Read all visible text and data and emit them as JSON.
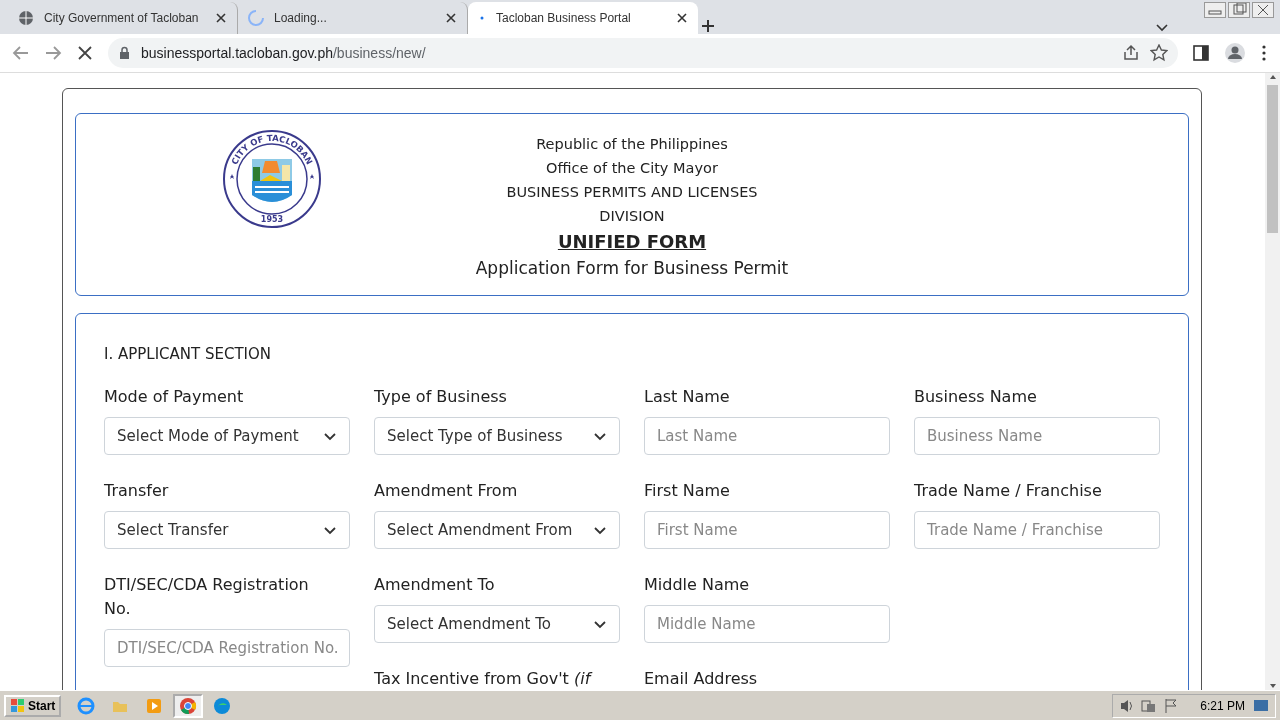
{
  "browser": {
    "tabs": [
      {
        "title": "City Government of Tacloban",
        "selected": false
      },
      {
        "title": "Loading...",
        "selected": false
      },
      {
        "title": "Tacloban Business Portal",
        "selected": true
      }
    ],
    "url_host": "businessportal.tacloban.gov.ph",
    "url_path": "/business/new/"
  },
  "header": {
    "lines": [
      "Republic of the Philippines",
      "Office of the City Mayor",
      "BUSINESS PERMITS AND LICENSES DIVISION"
    ],
    "title": "UNIFIED FORM",
    "subtitle": "Application Form for Business Permit",
    "seal": {
      "top": "CITY OF TACLOBAN",
      "year": "1953"
    }
  },
  "section": {
    "title": "I. APPLICANT SECTION",
    "columns": [
      [
        {
          "kind": "select",
          "label": "Mode of Payment",
          "value": "Select Mode of Payment"
        },
        {
          "kind": "select",
          "label": "Transfer",
          "value": "Select Transfer"
        },
        {
          "kind": "input",
          "label": "DTI/SEC/CDA Registration No.",
          "placeholder": "DTI/SEC/CDA Registration No."
        }
      ],
      [
        {
          "kind": "select",
          "label": "Type of Business",
          "value": "Select Type of Business"
        },
        {
          "kind": "select",
          "label": "Amendment From",
          "value": "Select Amendment From"
        },
        {
          "kind": "select",
          "label": "Amendment To",
          "value": "Select Amendment To"
        },
        {
          "kind": "label",
          "label": "Tax Incentive from Gov't *(if*"
        }
      ],
      [
        {
          "kind": "input",
          "label": "Last Name",
          "placeholder": "Last Name"
        },
        {
          "kind": "input",
          "label": "First Name",
          "placeholder": "First Name"
        },
        {
          "kind": "input",
          "label": "Middle Name",
          "placeholder": "Middle Name"
        },
        {
          "kind": "label",
          "label": "Email Address"
        }
      ],
      [
        {
          "kind": "input",
          "label": "Business Name",
          "placeholder": "Business Name"
        },
        {
          "kind": "input",
          "label": "Trade Name / Franchise",
          "placeholder": "Trade Name / Franchise"
        }
      ]
    ]
  },
  "taskbar": {
    "start": "Start",
    "apps": [
      {
        "selected": false
      },
      {
        "selected": false
      },
      {
        "selected": false
      },
      {
        "selected": true
      },
      {
        "selected": false
      }
    ],
    "time": "6:21 PM"
  }
}
